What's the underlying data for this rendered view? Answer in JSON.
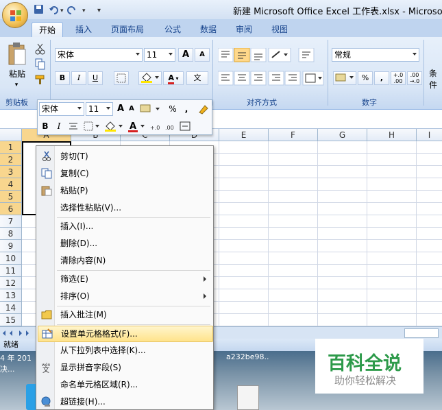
{
  "window": {
    "title": "新建 Microsoft Office Excel 工作表.xlsx - Microsoft E"
  },
  "ribbon": {
    "tabs": [
      "开始",
      "插入",
      "页面布局",
      "公式",
      "数据",
      "审阅",
      "视图"
    ],
    "active_tab": "开始",
    "clipboard": {
      "paste_label": "粘贴",
      "group_label": "剪贴板"
    },
    "font": {
      "name": "宋体",
      "size": "11",
      "bold": "B",
      "italic": "I",
      "underline": "U",
      "grow": "A",
      "shrink": "A",
      "color": "A",
      "phonetic": "文"
    },
    "alignment": {
      "group_label": "对齐方式"
    },
    "number": {
      "format": "常规",
      "percent": "%",
      "comma": ",",
      "group_label": "数字",
      "inc_decimal": "+.0 .00",
      "dec_decimal": ".00 →.0"
    },
    "styles_partial": "条件"
  },
  "mini_toolbar": {
    "font": "宋体",
    "size": "11",
    "percent": "%",
    "comma": ",",
    "bold": "B",
    "italic": "I",
    "inc_decimal": "+.0",
    "dec_decimal": ".00"
  },
  "grid": {
    "columns": [
      "A",
      "B",
      "C",
      "D",
      "E",
      "F",
      "G",
      "H",
      "I"
    ],
    "rows": [
      "1",
      "2",
      "3",
      "4",
      "5",
      "6",
      "7",
      "8",
      "9",
      "10",
      "11",
      "12",
      "13",
      "14",
      "15"
    ]
  },
  "status": {
    "ready": "就绪"
  },
  "taskbar_text": {
    "left": "4 年 201",
    "right": "a232be98..",
    "left2": "决..."
  },
  "context_menu": {
    "items": [
      {
        "label": "剪切(T)",
        "icon": "scissors-icon"
      },
      {
        "label": "复制(C)",
        "icon": "copy-icon"
      },
      {
        "label": "粘贴(P)",
        "icon": "paste-icon"
      },
      {
        "label": "选择性粘贴(V)...",
        "icon": ""
      },
      {
        "label": "插入(I)...",
        "icon": ""
      },
      {
        "label": "删除(D)...",
        "icon": ""
      },
      {
        "label": "清除内容(N)",
        "icon": ""
      },
      {
        "label": "筛选(E)",
        "icon": "",
        "submenu": true
      },
      {
        "label": "排序(O)",
        "icon": "",
        "submenu": true
      },
      {
        "label": "插入批注(M)",
        "icon": "comment-icon"
      },
      {
        "label": "设置单元格格式(F)...",
        "icon": "format-cells-icon",
        "highlighted": true
      },
      {
        "label": "从下拉列表中选择(K)...",
        "icon": ""
      },
      {
        "label": "显示拼音字段(S)",
        "icon": "phonetic-icon"
      },
      {
        "label": "命名单元格区域(R)...",
        "icon": ""
      },
      {
        "label": "超链接(H)...",
        "icon": "hyperlink-icon"
      }
    ]
  },
  "watermark": {
    "title": "百科全说",
    "subtitle": "助你轻松解决"
  },
  "colors": {
    "accent": "#15428b",
    "highlight": "#ffe38a",
    "watermark_green": "#2d9a4a"
  }
}
